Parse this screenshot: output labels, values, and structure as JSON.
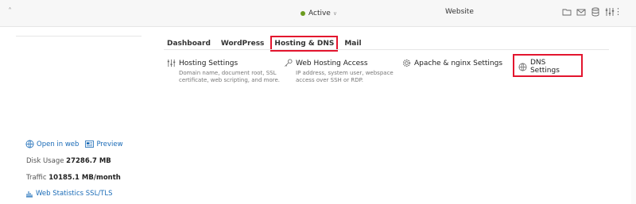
{
  "topbar": {
    "status_label": "Active",
    "site_label": "Website",
    "icons": [
      "folder-icon",
      "mail-icon",
      "database-icon",
      "settings-sliders-icon",
      "more-options-icon"
    ]
  },
  "tabs": [
    {
      "label": "Dashboard",
      "active": false
    },
    {
      "label": "WordPress",
      "active": false
    },
    {
      "label": "Hosting & DNS",
      "active": true
    },
    {
      "label": "Mail",
      "active": false
    }
  ],
  "cards": {
    "hosting": {
      "title": "Hosting Settings",
      "desc": "Domain name, document root, SSL certificate, web scripting, and more."
    },
    "access": {
      "title": "Web Hosting Access",
      "desc": "IP address, system user, webspace access over SSH or RDP."
    },
    "apache": {
      "title": "Apache & nginx Settings"
    },
    "dns": {
      "title": "DNS Settings"
    }
  },
  "left": {
    "open_in_web": "Open in web",
    "preview": "Preview",
    "disk_label": "Disk Usage",
    "disk_value": "27286.7 MB",
    "traffic_label": "Traffic",
    "traffic_value": "10185.1 MB/month",
    "web_stats": "Web Statistics SSL/TLS"
  },
  "colors": {
    "accent_red": "#e3152e",
    "link_blue": "#1a6bb7",
    "status_green": "#6b9b1f"
  }
}
